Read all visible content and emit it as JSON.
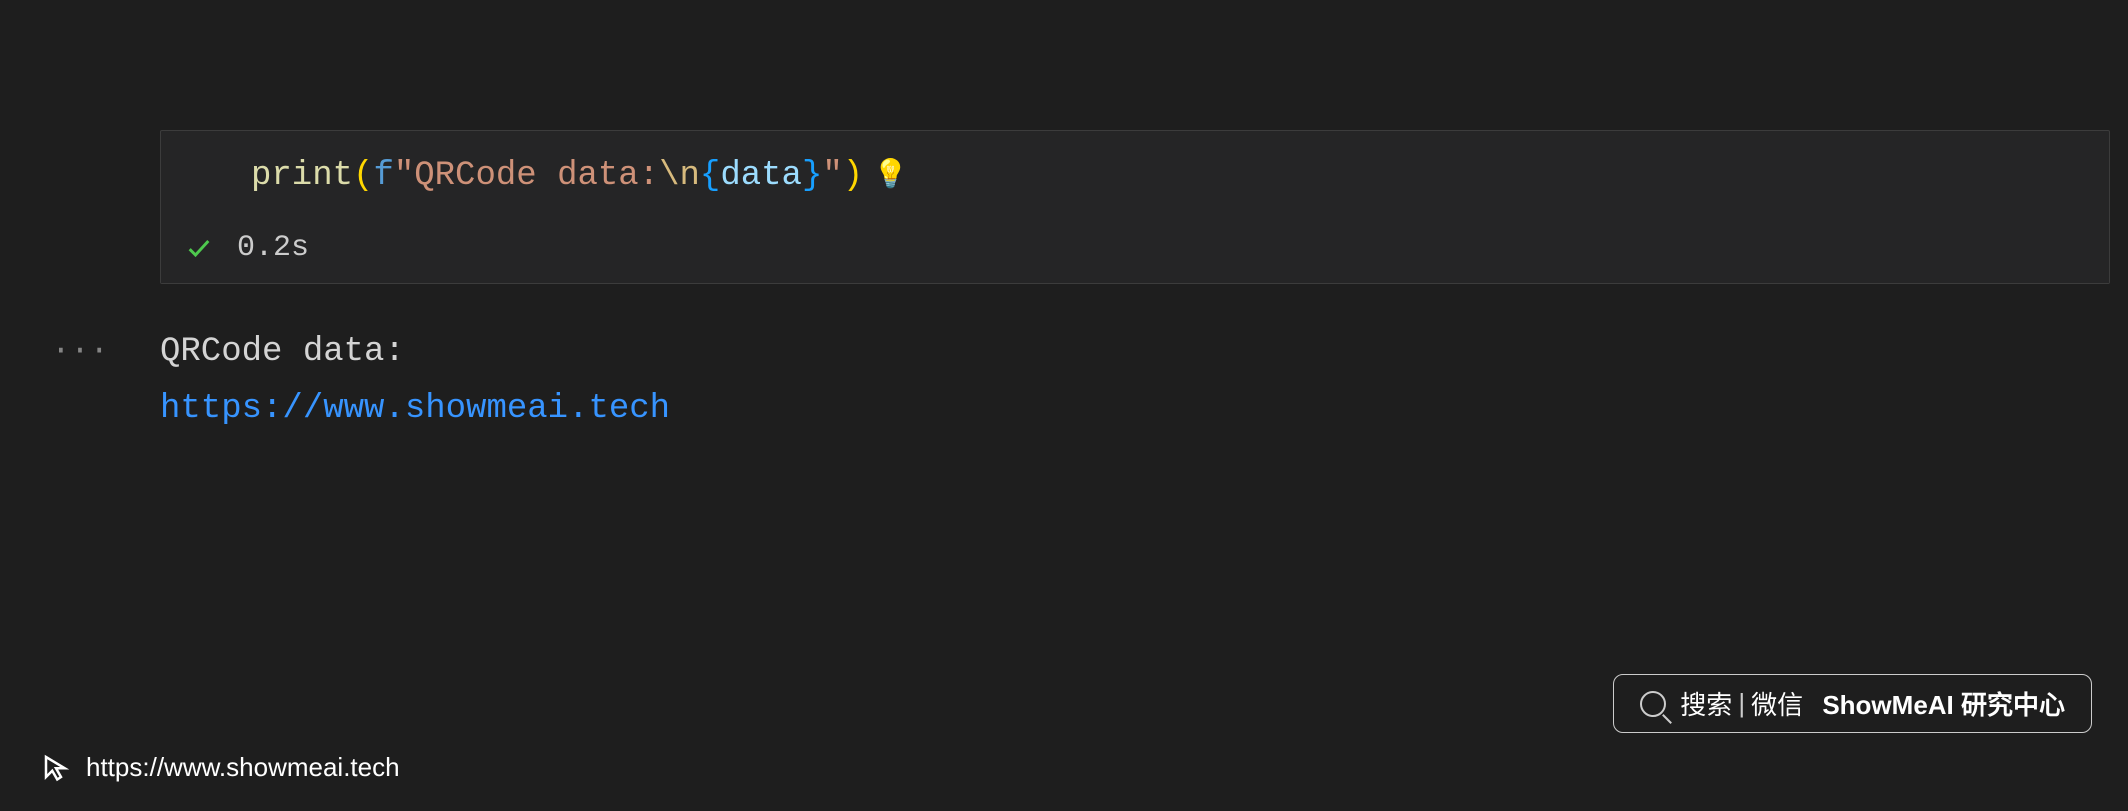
{
  "code_cell": {
    "tokens": {
      "print": "print",
      "lparen": "(",
      "f_prefix": "f",
      "quote1": "\"",
      "string_part1": "QRCode data:",
      "escape": "\\n",
      "lbrace": "{",
      "variable": "data",
      "rbrace": "}",
      "quote2": "\"",
      "rparen": ")"
    },
    "status": {
      "execution_time": "0.2s"
    }
  },
  "output": {
    "ellipsis": "···",
    "line1": "QRCode data:",
    "line2": "https://www.showmeai.tech"
  },
  "search_widget": {
    "label_search": "搜索",
    "label_wechat": "微信",
    "brand": "ShowMeAI 研究中心"
  },
  "footer": {
    "url": "https://www.showmeai.tech"
  }
}
